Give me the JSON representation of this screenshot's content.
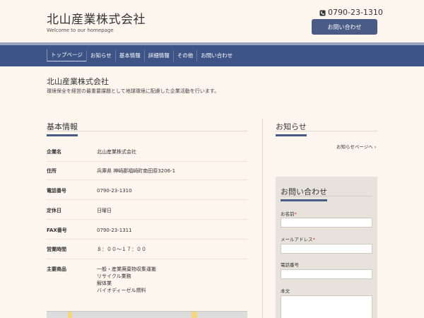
{
  "header": {
    "site_title": "北山産業株式会社",
    "tagline": "Welcome to our homepage",
    "phone": "0790-23-1310",
    "contact_button": "お問い合わせ"
  },
  "nav": {
    "items": [
      {
        "label": "トップページ",
        "active": true
      },
      {
        "label": "お知らせ",
        "active": false
      },
      {
        "label": "基本情報",
        "active": false
      },
      {
        "label": "詳細情報",
        "active": false
      },
      {
        "label": "その他",
        "active": false
      },
      {
        "label": "お問い合わせ",
        "active": false
      }
    ]
  },
  "intro": {
    "title": "北山産業株式会社",
    "text": "環境保全を経営の最重要課題として地球環境に配慮した企業活動を行います。"
  },
  "basic_info": {
    "heading": "基本情報",
    "rows": [
      {
        "label": "企業名",
        "value": "北山産業株式会社"
      },
      {
        "label": "住所",
        "value": "兵庫県 神崎郡福崎町南田原3206-1"
      },
      {
        "label": "電話番号",
        "value": "0790-23-1310"
      },
      {
        "label": "定休日",
        "value": "日曜日"
      },
      {
        "label": "FAX番号",
        "value": "0790-23-1311"
      },
      {
        "label": "営業時間",
        "value": "８：００～１７：００"
      },
      {
        "label": "主要商品",
        "value_lines": [
          "一般・産業廃棄物収集運搬",
          "リサイクル業務",
          "解体業",
          "バイオディーゼル燃料"
        ]
      }
    ]
  },
  "news": {
    "heading": "お知らせ",
    "link": "お知らせページへ ›"
  },
  "contact_form": {
    "heading": "お問い合わせ",
    "name_label": "お名前",
    "email_label": "メールアドレス",
    "phone_label": "電話番号",
    "body_label": "本文",
    "required_mark": "*"
  },
  "colors": {
    "background": "#fdf6ee",
    "nav": "#3f5486",
    "accent": "#4a5c86",
    "form_bg": "#e7e2dc"
  }
}
